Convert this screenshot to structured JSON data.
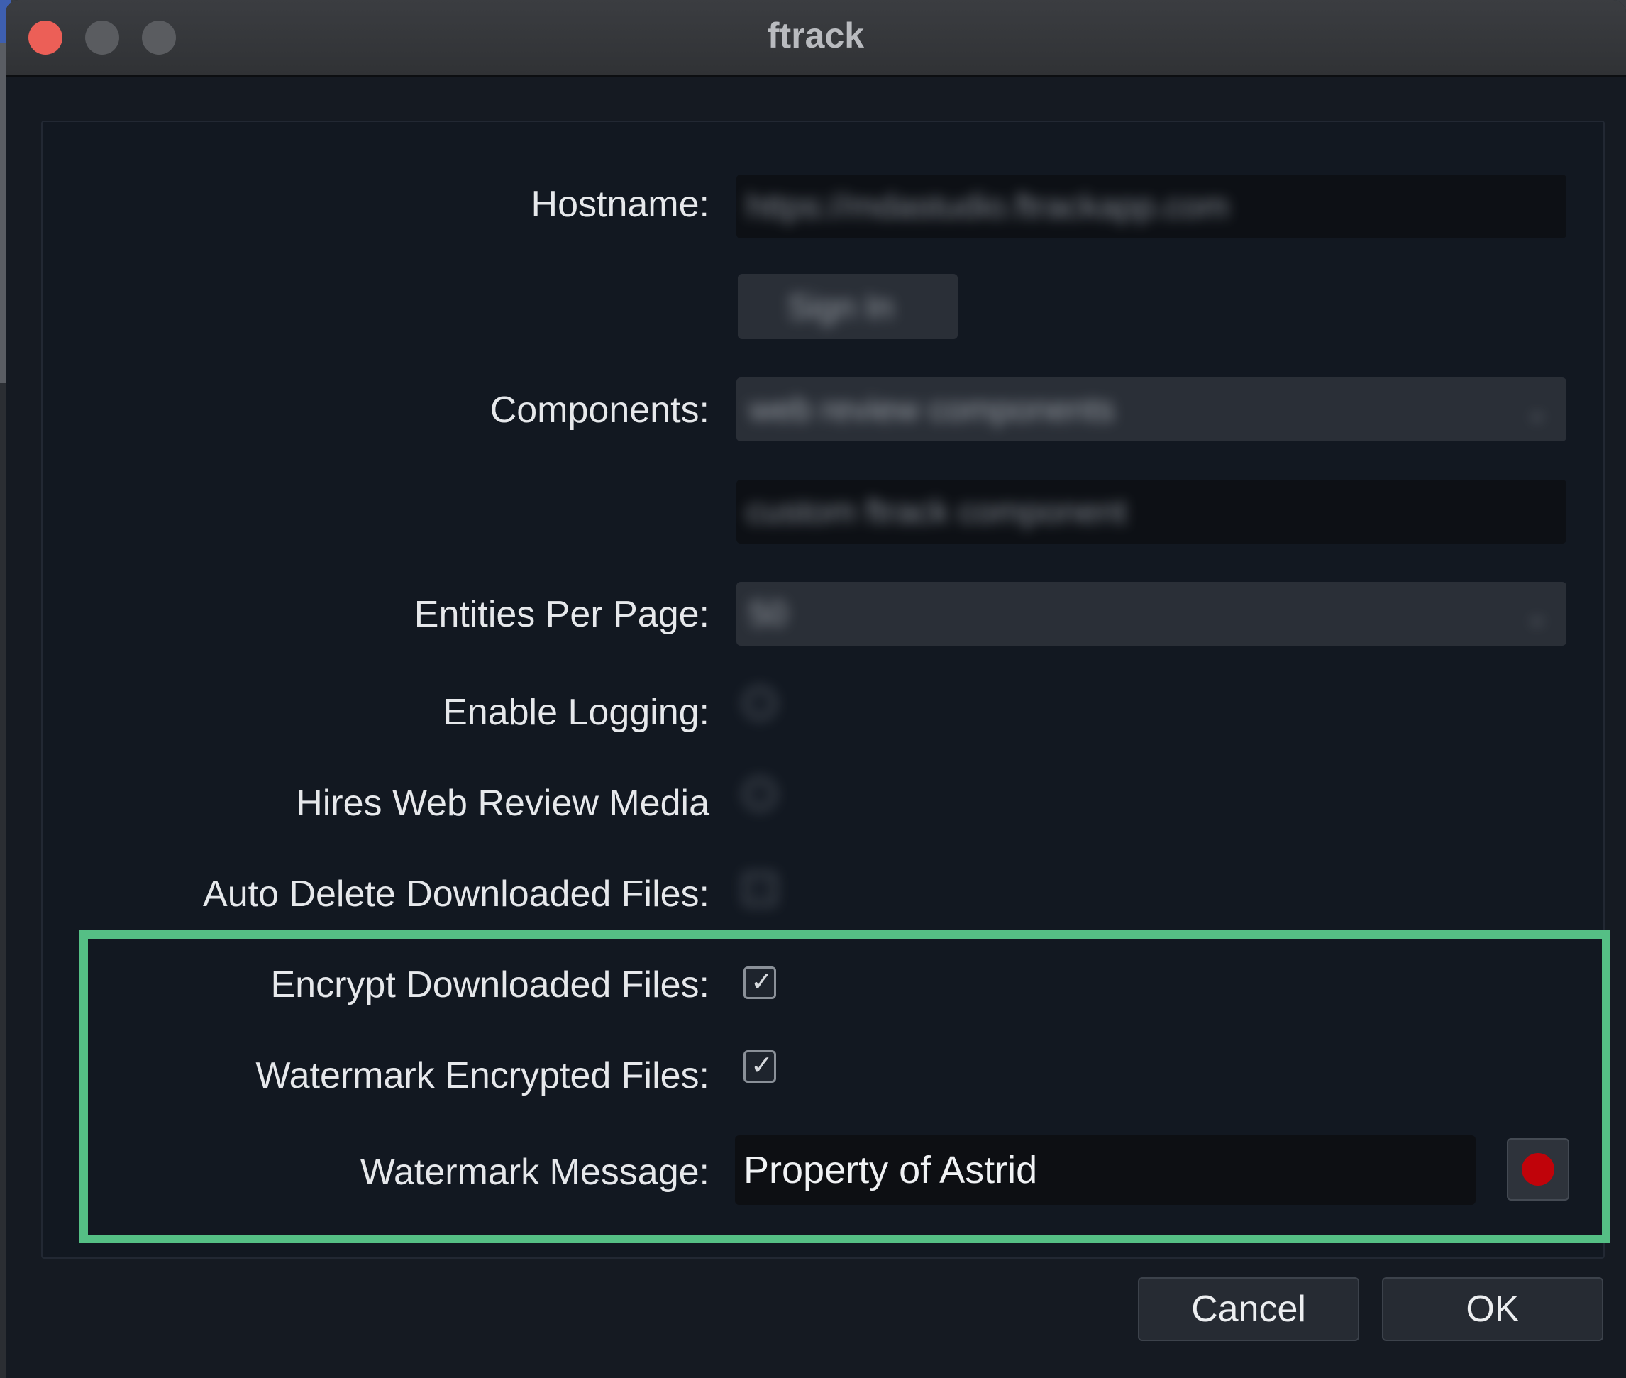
{
  "window": {
    "title": "ftrack"
  },
  "form": {
    "hostname": {
      "label": "Hostname:",
      "value": "https://mdastudio.ftrackapp.com"
    },
    "signin": {
      "label": "Sign In"
    },
    "components": {
      "label": "Components:",
      "value": "web review components",
      "custom_placeholder": "custom ftrack component"
    },
    "entities_per_page": {
      "label": "Entities Per Page:",
      "value": "50"
    },
    "enable_logging": {
      "label": "Enable Logging:",
      "checked": false
    },
    "hires_web_review": {
      "label": "Hires Web Review Media",
      "checked": false
    },
    "auto_delete": {
      "label": "Auto Delete Downloaded Files:",
      "checked": false
    },
    "encrypt_downloaded": {
      "label": "Encrypt Downloaded Files:",
      "checked": true
    },
    "watermark_encrypted": {
      "label": "Watermark Encrypted Files:",
      "checked": true
    },
    "watermark_message": {
      "label": "Watermark Message:",
      "value": "Property of Astrid",
      "color": "#c0030a"
    }
  },
  "buttons": {
    "cancel": "Cancel",
    "ok": "OK"
  },
  "check_glyph": "✓",
  "combo_arrow": "⌄"
}
